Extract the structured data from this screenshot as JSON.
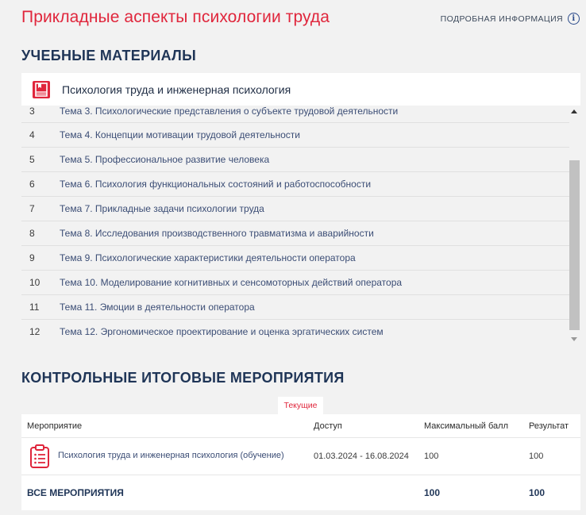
{
  "course_title": "Прикладные аспекты психологии труда",
  "info_link": "ПОДРОБНАЯ ИНФОРМАЦИЯ",
  "materials_section": {
    "title": "УЧЕБНЫЕ МАТЕРИАЛЫ",
    "material_title": "Психология труда и инженерная психология",
    "topics": [
      {
        "num": "3",
        "name": "Тема 3. Психологические представления о субъекте трудовой деятельности"
      },
      {
        "num": "4",
        "name": "Тема 4. Концепции мотивации трудовой деятельности"
      },
      {
        "num": "5",
        "name": "Тема 5. Профессиональное развитие человека"
      },
      {
        "num": "6",
        "name": "Тема 6. Психология функциональных состояний и работоспособности"
      },
      {
        "num": "7",
        "name": "Тема 7. Прикладные задачи психологии труда"
      },
      {
        "num": "8",
        "name": "Тема 8. Исследования производственного травматизма и аварийности"
      },
      {
        "num": "9",
        "name": "Тема 9. Психологические характеристики деятельности оператора"
      },
      {
        "num": "10",
        "name": "Тема 10. Моделирование когнитивных и сенсомоторных действий оператора"
      },
      {
        "num": "11",
        "name": "Тема 11. Эмоции в деятельности оператора"
      },
      {
        "num": "12",
        "name": "Тема 12. Эргономическое проектирование и оценка эргатических систем"
      }
    ]
  },
  "events_section": {
    "title": "КОНТРОЛЬНЫЕ ИТОГОВЫЕ МЕРОПРИЯТИЯ",
    "filter_tab": "Текущие",
    "columns": {
      "event": "Мероприятие",
      "access": "Доступ",
      "max_score": "Максимальный балл",
      "result": "Результат"
    },
    "rows": [
      {
        "name": "Психология труда и инженерная психология (обучение)",
        "access": "01.03.2024 - 16.08.2024",
        "max_score": "100",
        "result": "100"
      }
    ],
    "total": {
      "label": "ВСЕ МЕРОПРИЯТИЯ",
      "max_score": "100",
      "result": "100"
    }
  },
  "colors": {
    "accent_red": "#e0263c",
    "heading_navy": "#1f3557",
    "link_blue": "#3b4d75"
  }
}
